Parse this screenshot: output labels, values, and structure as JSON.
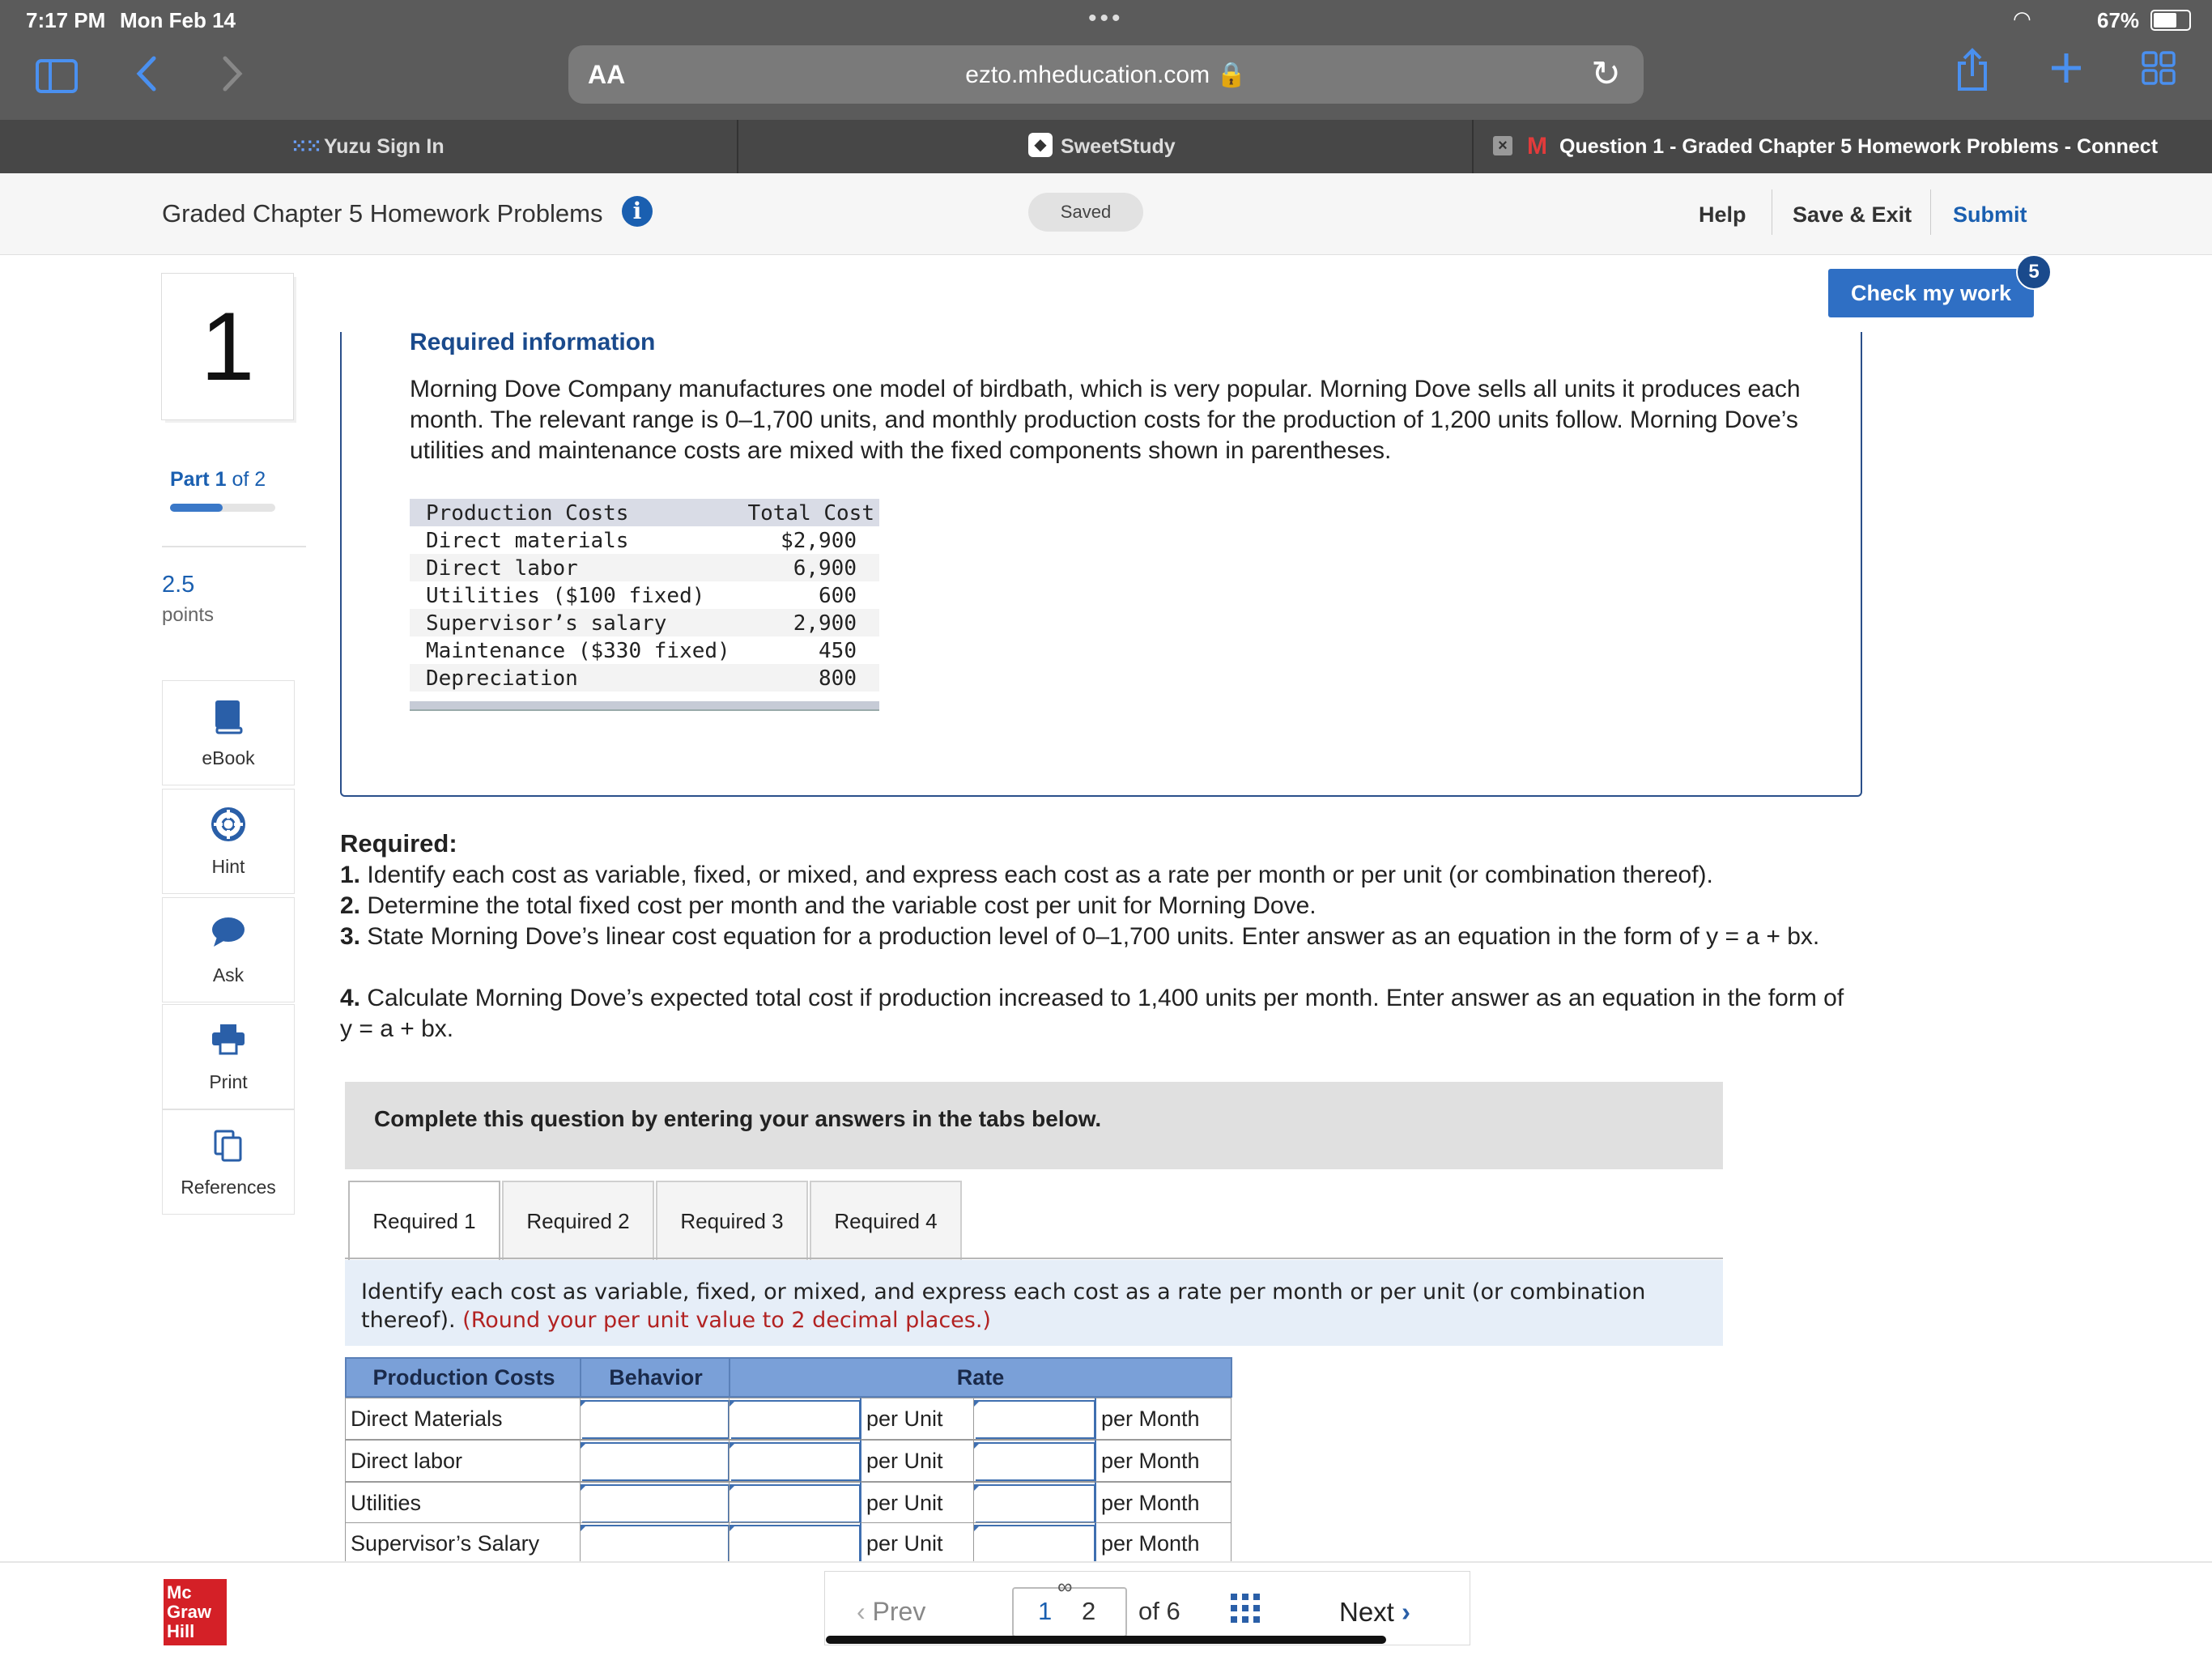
{
  "status_bar": {
    "time": "7:17 PM",
    "date": "Mon Feb 14",
    "dots": "•••",
    "battery": "67%"
  },
  "browser": {
    "text_size_btn": "AA",
    "url": "ezto.mheducation.com 🔒",
    "tabs": [
      {
        "label": "Yuzu Sign In"
      },
      {
        "label": "SweetStudy"
      },
      {
        "label": "Question 1 - Graded Chapter 5 Homework Problems - Connect",
        "prefix": "M"
      }
    ]
  },
  "header": {
    "title": "Graded Chapter 5 Homework Problems",
    "info": "i",
    "saved": "Saved",
    "help": "Help",
    "save_exit": "Save & Exit",
    "submit": "Submit"
  },
  "question": {
    "number": "1",
    "part_label": "Part",
    "part_num": "1",
    "part_of": "of 2",
    "part_progress": 0.5,
    "points": "2.5",
    "points_label": "points"
  },
  "tools": [
    {
      "label": "eBook",
      "icon": "book-icon"
    },
    {
      "label": "Hint",
      "icon": "lifebuoy-icon"
    },
    {
      "label": "Ask",
      "icon": "chat-bubble-icon"
    },
    {
      "label": "Print",
      "icon": "printer-icon"
    },
    {
      "label": "References",
      "icon": "copy-icon"
    }
  ],
  "check_my_work": {
    "label": "Check my work",
    "badge": "5"
  },
  "info": {
    "heading": "Required information",
    "paragraph": "Morning Dove Company manufactures one model of birdbath, which is very popular. Morning Dove sells all units it produces each month. The relevant range is 0–1,700 units, and monthly production costs for the production of 1,200 units follow. Morning Dove’s utilities and maintenance costs are mixed with the fixed components shown in parentheses.",
    "cost_table": {
      "headers": [
        "Production Costs",
        "Total Cost"
      ],
      "rows": [
        [
          "Direct materials",
          "$2,900"
        ],
        [
          "Direct labor",
          "6,900"
        ],
        [
          "Utilities ($100 fixed)",
          "600"
        ],
        [
          "Supervisor’s salary",
          "2,900"
        ],
        [
          "Maintenance ($330 fixed)",
          "450"
        ],
        [
          "Depreciation",
          "800"
        ]
      ]
    }
  },
  "required": {
    "heading": "Required:",
    "items": [
      {
        "num": "1.",
        "text": " Identify each cost as variable, fixed, or mixed, and express each cost as a rate per month or per unit (or combination thereof)."
      },
      {
        "num": "2.",
        "text": " Determine the total fixed cost per month and the variable cost per unit for Morning Dove."
      },
      {
        "num": "3.",
        "text": " State Morning Dove’s linear cost equation for a production level of 0–1,700 units. Enter answer as an equation in the form of y = a + bx."
      },
      {
        "num": "4.",
        "text": " Calculate Morning Dove’s expected total cost if production increased to 1,400 units per month. Enter answer as an equation in the form of y = a + bx."
      }
    ]
  },
  "complete_box": "Complete this question by entering your answers in the tabs below.",
  "answer_tabs": [
    "Required 1",
    "Required 2",
    "Required 3",
    "Required 4"
  ],
  "instructions": {
    "text": "Identify each cost as variable, fixed, or mixed, and express each cost as a rate per month or per unit (or combination thereof).",
    "note": "(Round your per unit value to 2 decimal places.)"
  },
  "answer_table": {
    "headers": [
      "Production Costs",
      "Behavior",
      "Rate"
    ],
    "rows": [
      {
        "label": "Direct Materials",
        "unit": "per Unit",
        "month": "per Month"
      },
      {
        "label": "Direct labor",
        "unit": "per Unit",
        "month": "per Month"
      },
      {
        "label": "Utilities",
        "unit": "per Unit",
        "month": "per Month"
      },
      {
        "label": "Supervisor’s Salary",
        "unit": "per Unit",
        "month": "per Month"
      }
    ]
  },
  "pagination": {
    "prev": "Prev",
    "current": "1",
    "next_page": "2",
    "of": "of 6",
    "next": "Next"
  },
  "logo": [
    "Mc",
    "Graw",
    "Hill"
  ]
}
